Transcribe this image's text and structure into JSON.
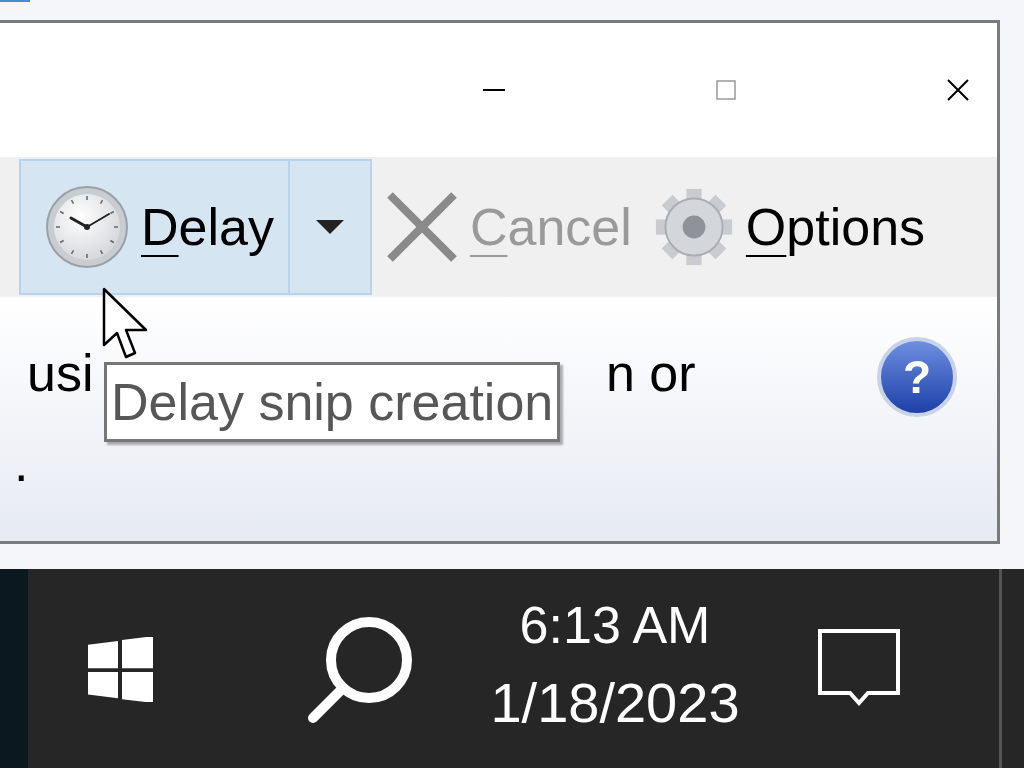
{
  "window": {
    "controls": [
      {
        "kind": "minimize"
      },
      {
        "kind": "maximize"
      },
      {
        "kind": "close"
      }
    ]
  },
  "toolbar": {
    "buttons": [
      {
        "kind": "clock",
        "label": "Delay",
        "highlighted": true,
        "disabled": false,
        "dropdown": true
      },
      {
        "kind": "cancel",
        "label": "Cancel",
        "highlighted": false,
        "disabled": true,
        "dropdown": false
      },
      {
        "kind": "gear",
        "label": "Options",
        "highlighted": false,
        "disabled": false,
        "dropdown": false
      }
    ]
  },
  "body": {
    "line_1_start": "usi",
    "line_1_end": "n or",
    "line_2": ".",
    "help": "?"
  },
  "tooltip": "Delay snip creation",
  "taskbar": {
    "time": "6:13 AM",
    "date": "1/18/2023"
  }
}
